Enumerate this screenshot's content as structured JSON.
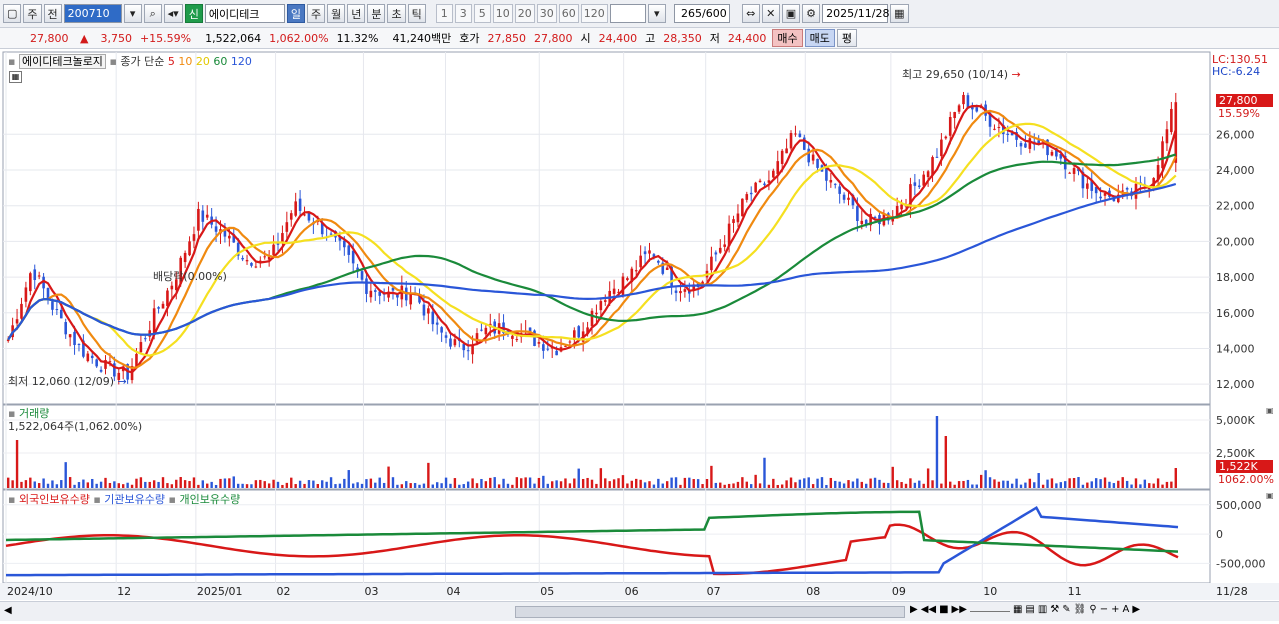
{
  "toolbar": {
    "period_button": "주",
    "prev_label": "전",
    "stock_code": "200710",
    "badge_new": "신",
    "stock_name": "에이디테크",
    "timeframes": [
      "일",
      "주",
      "월",
      "년",
      "분",
      "초",
      "틱"
    ],
    "active_timeframe": "일",
    "intervals": [
      "1",
      "3",
      "5",
      "10",
      "20",
      "30",
      "60",
      "120"
    ],
    "count": "265",
    "count_max": "/600",
    "date": "2025/11/28"
  },
  "quote": {
    "price": "27,800",
    "change_sign": "▲",
    "change": "3,750",
    "change_pct": "+15.59%",
    "volume": "1,522,064",
    "volume_pct": "1,062.00%",
    "turnover_pct": "11.32%",
    "amount": "41,240백만",
    "bid_label": "호가",
    "bid": "27,850",
    "ask": "27,800",
    "open_label": "시",
    "open": "24,400",
    "high_label": "고",
    "high": "28,350",
    "low_label": "저",
    "low": "24,400",
    "buy_label": "매수",
    "sell_label": "매도",
    "eval_label": "평"
  },
  "price_panel": {
    "title": "에이디테크놀로지",
    "ma_label": "종가 단순",
    "ma_periods": [
      "5",
      "10",
      "20",
      "60",
      "120"
    ],
    "ma_colors": [
      "#d81818",
      "#f08a10",
      "#f5e020",
      "#1a8a3a",
      "#2a56d8"
    ],
    "lc": "LC:130.51",
    "hc": "HC:-6.24",
    "y_ticks": [
      "26,000",
      "24,000",
      "22,000",
      "20,000",
      "18,000",
      "16,000",
      "14,000",
      "12,000"
    ],
    "current_price_tag": "27,800",
    "current_pct_tag": "15.59%",
    "high_note": "최고 29,650 (10/14)",
    "low_note": "최저 12,060 (12/09)",
    "dividend_note": "배당락(0.00%)"
  },
  "volume_panel": {
    "title": "거래량",
    "value_note": "1,522,064주(1,062.00%)",
    "y_ticks": [
      "5,000K",
      "2,500K"
    ],
    "current_tag": "1,522K",
    "current_pct_tag": "1062.00%"
  },
  "holdings_panel": {
    "series": [
      "외국인보유수량",
      "기관보유수량",
      "개인보유수량"
    ],
    "series_colors": [
      "#d81818",
      "#2a56d8",
      "#1a8a3a"
    ],
    "y_ticks": [
      "500,000",
      "0",
      "-500,000"
    ]
  },
  "x_axis": {
    "labels": [
      "2024/10",
      "12",
      "2025/01",
      "02",
      "03",
      "04",
      "05",
      "06",
      "07",
      "08",
      "09",
      "10",
      "11"
    ],
    "right_label": "11/28"
  },
  "chart_data": [
    {
      "type": "candlestick",
      "title": "에이디테크놀로지",
      "x_range": [
        "2024/10",
        "2025/11/28"
      ],
      "ylim": [
        11000,
        30500
      ],
      "closes_approx": [
        14500,
        18500,
        16000,
        14000,
        13000,
        12500,
        15500,
        18000,
        21500,
        20500,
        19000,
        19000,
        22000,
        21000,
        19500,
        17500,
        17000,
        17200,
        15000,
        14000,
        15000,
        15200,
        14500,
        14000,
        15000,
        17000,
        18000,
        19500,
        17500,
        17500,
        20000,
        22500,
        23500,
        26000,
        24000,
        22500,
        21000,
        21500,
        23000,
        25000,
        28000,
        27000,
        26000,
        25500,
        25000,
        23500,
        22500,
        22500,
        23500,
        27800
      ],
      "last_close": 27800,
      "high": 29650,
      "low": 12060
    },
    {
      "type": "bar",
      "title": "거래량",
      "last_value": 1522064
    },
    {
      "type": "line",
      "series": [
        {
          "name": "외국인보유수량"
        },
        {
          "name": "기관보유수량"
        },
        {
          "name": "개인보유수량"
        }
      ],
      "ylim": [
        -800000,
        650000
      ]
    }
  ]
}
